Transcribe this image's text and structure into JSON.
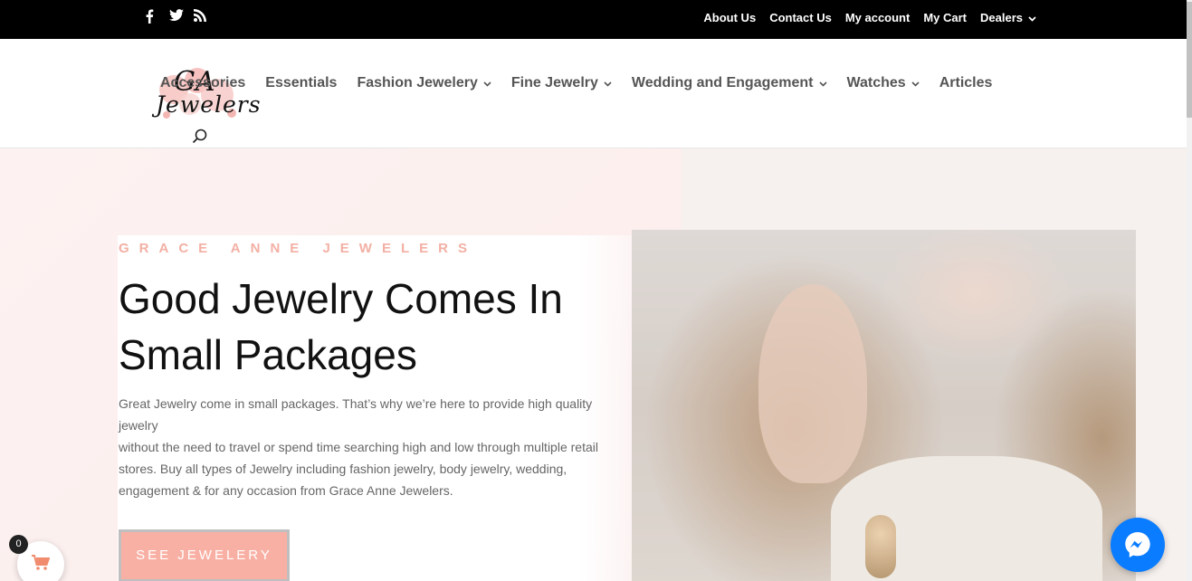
{
  "topbar": {
    "social": [
      "facebook-icon",
      "twitter-icon",
      "rss-icon"
    ],
    "links": {
      "about": "About Us",
      "contact": "Contact Us",
      "account": "My account",
      "cart": "My Cart",
      "dealers": "Dealers"
    }
  },
  "logo": {
    "line1": "GA",
    "line2": "Jewelers"
  },
  "nav": {
    "items": [
      {
        "label": "Accessories",
        "has_dropdown": false
      },
      {
        "label": "Essentials",
        "has_dropdown": false
      },
      {
        "label": "Fashion Jewelery",
        "has_dropdown": true
      },
      {
        "label": "Fine Jewelry",
        "has_dropdown": true
      },
      {
        "label": "Wedding and Engagement",
        "has_dropdown": true
      },
      {
        "label": "Watches",
        "has_dropdown": true
      },
      {
        "label": "Articles",
        "has_dropdown": false
      }
    ]
  },
  "hero": {
    "eyebrow": "GRACE ANNE JEWELERS",
    "headline_line1": "Good Jewelry Comes In",
    "headline_line2": "Small Packages",
    "body_line1": "Great Jewelry come in small packages. That’s why we’re here to provide high quality jewelry",
    "body_line2": "without the need to travel or spend time searching high and low through multiple retail stores. Buy all types of Jewelry including fashion jewelry, body jewelry, wedding, engagement & for any occasion from Grace Anne Jewelers.",
    "cta": "SEE JEWELERY"
  },
  "cart_widget": {
    "count": "0"
  },
  "colors": {
    "accent": "#f9b0a4",
    "topbar": "#000000",
    "messenger": "#0a7cff"
  }
}
